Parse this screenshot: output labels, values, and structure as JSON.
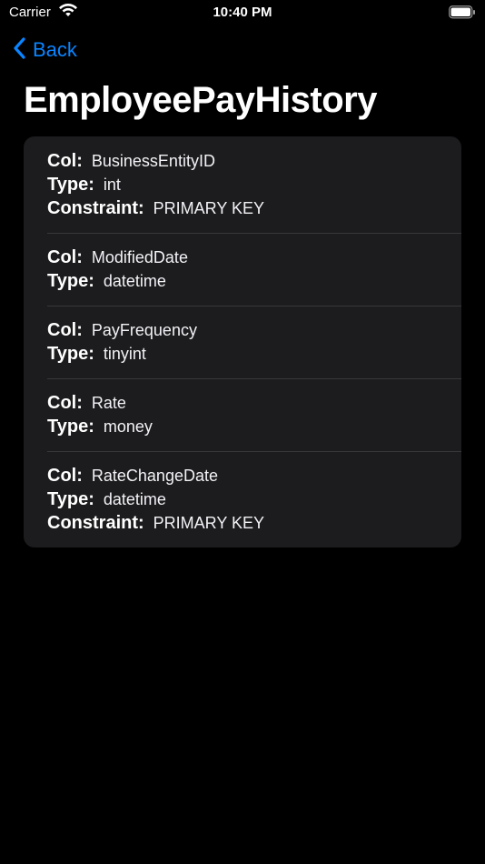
{
  "status": {
    "carrier": "Carrier",
    "time": "10:40 PM"
  },
  "nav": {
    "back_label": "Back"
  },
  "page": {
    "title": "EmployeePayHistory"
  },
  "labels": {
    "col": "Col:",
    "type": "Type:",
    "constraint": "Constraint:"
  },
  "columns": [
    {
      "name": "BusinessEntityID",
      "type": "int",
      "constraint": "PRIMARY KEY"
    },
    {
      "name": "ModifiedDate",
      "type": "datetime"
    },
    {
      "name": "PayFrequency",
      "type": "tinyint"
    },
    {
      "name": "Rate",
      "type": "money"
    },
    {
      "name": "RateChangeDate",
      "type": "datetime",
      "constraint": "PRIMARY KEY"
    }
  ],
  "colors": {
    "accent": "#0a84ff",
    "card": "#1c1c1e",
    "background": "#000000"
  }
}
